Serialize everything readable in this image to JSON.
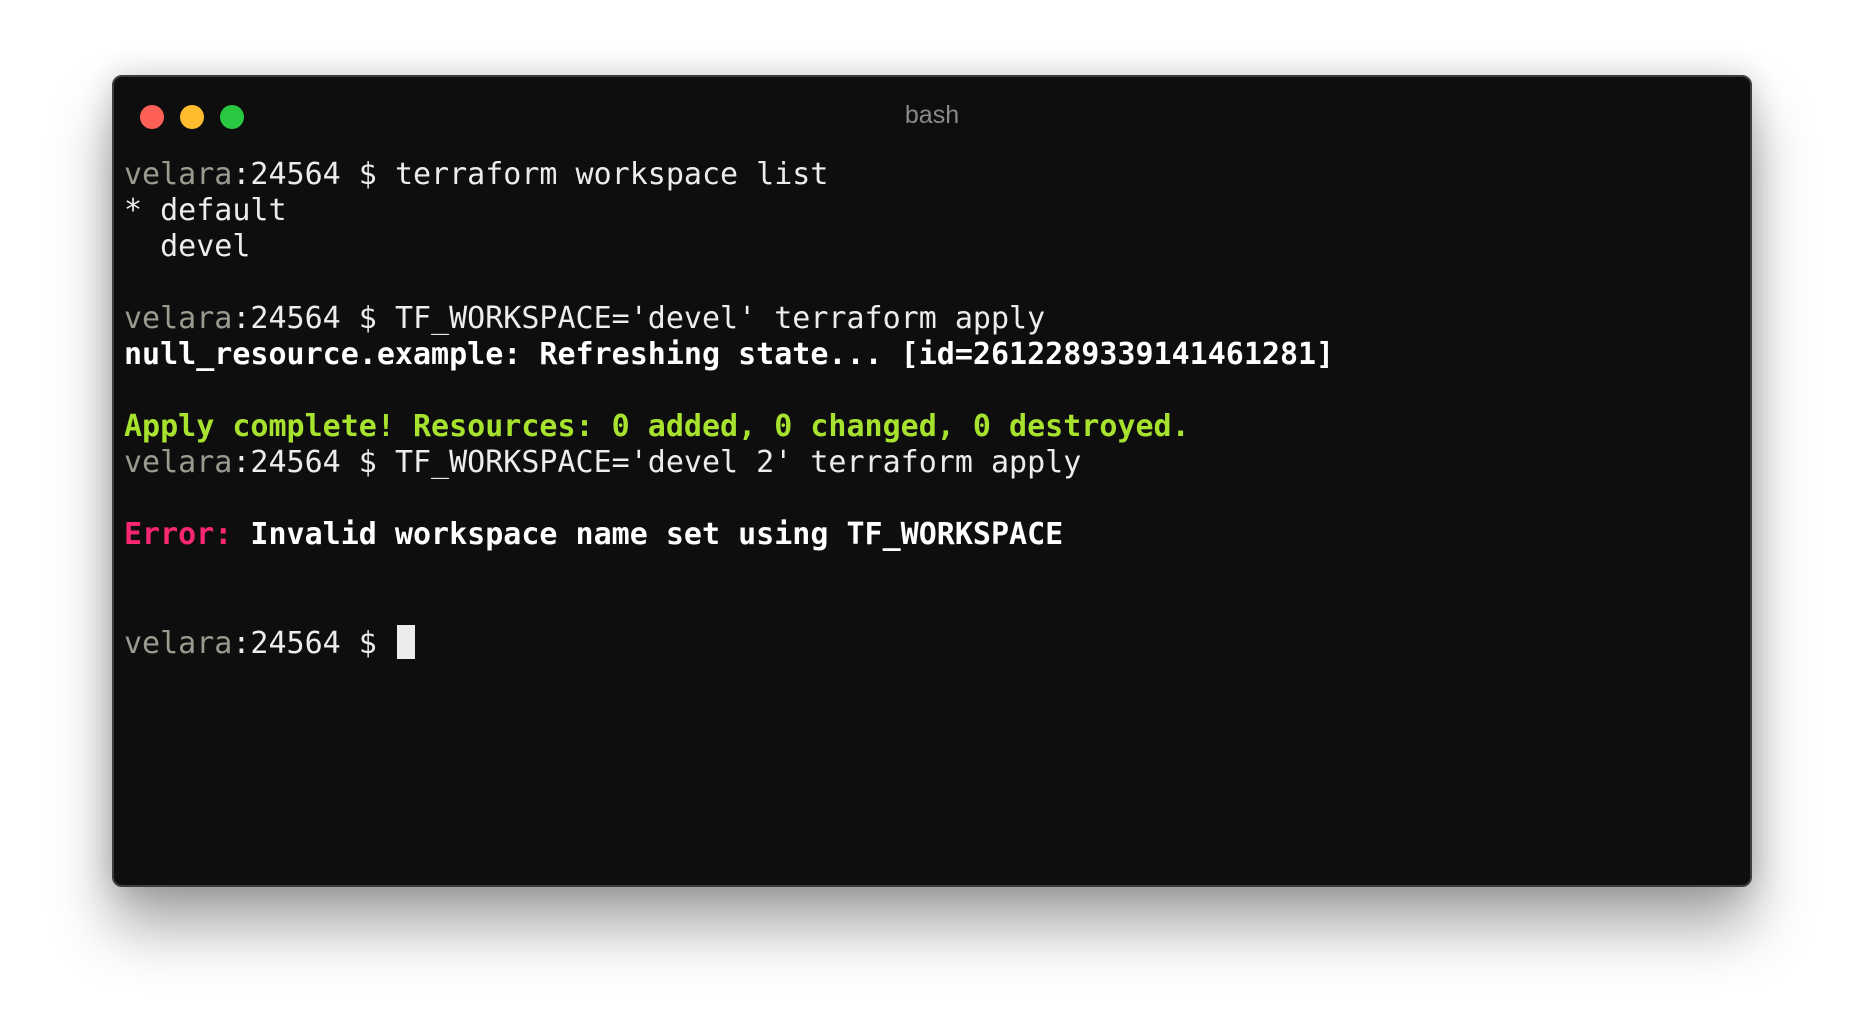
{
  "window": {
    "title": "bash",
    "buttons": {
      "close_color": "#fe5f57",
      "minimize_color": "#febc2e",
      "zoom_color": "#28c840"
    }
  },
  "theme": {
    "background": "#0e0e0e",
    "foreground": "#ececec",
    "host_color": "#9b9a8f",
    "success_color": "#a6e22e",
    "error_color": "#f92672"
  },
  "prompt": {
    "host": "velara",
    "rest": ":24564 $ "
  },
  "lines": {
    "cmd1": "terraform workspace list",
    "ws_default": "* default",
    "ws_devel": "  devel",
    "cmd2": "TF_WORKSPACE='devel' terraform apply",
    "refresh": "null_resource.example: Refreshing state... [id=2612289339141461281]",
    "apply_complete": "Apply complete! Resources: 0 added, 0 changed, 0 destroyed.",
    "cmd3": "TF_WORKSPACE='devel 2' terraform apply",
    "error_label": "Error:",
    "error_message": " Invalid workspace name set using TF_WORKSPACE"
  }
}
